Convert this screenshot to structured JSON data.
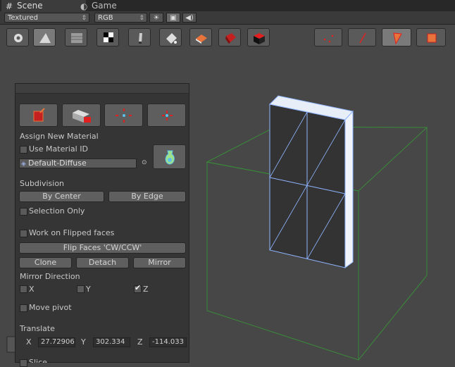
{
  "tabs": [
    {
      "label": "Scene",
      "icon": "grid-icon",
      "active": true
    },
    {
      "label": "Game",
      "icon": "pacman-icon",
      "active": false
    }
  ],
  "options": {
    "render_mode": "Textured",
    "color_mode": "RGB"
  },
  "panel": {
    "assign_material_label": "Assign New Material",
    "use_material_id_label": "Use Material ID",
    "material_name": "Default-Diffuse",
    "subdivision_label": "Subdivision",
    "by_center_label": "By Center",
    "by_edge_label": "By Edge",
    "selection_only_label": "Selection Only",
    "work_flipped_label": "Work on Flipped faces",
    "flip_faces_label": "Flip Faces 'CW/CCW'",
    "clone_label": "Clone",
    "detach_label": "Detach",
    "mirror_label": "Mirror",
    "mirror_direction_label": "Mirror Direction",
    "axis_x": "X",
    "axis_y": "Y",
    "axis_z": "Z",
    "mirror_z_checked": true,
    "move_pivot_label": "Move pivot",
    "translate_label": "Translate",
    "tx_value": "27.72906",
    "ty_value": "302.334",
    "tz_value": "-114.033",
    "slice_label": "Slice"
  },
  "colors": {
    "accent_red": "#e02020",
    "accent_orange": "#e8743b",
    "grid_green": "#3a8a3a",
    "mesh_blue": "#8fb4ff"
  }
}
